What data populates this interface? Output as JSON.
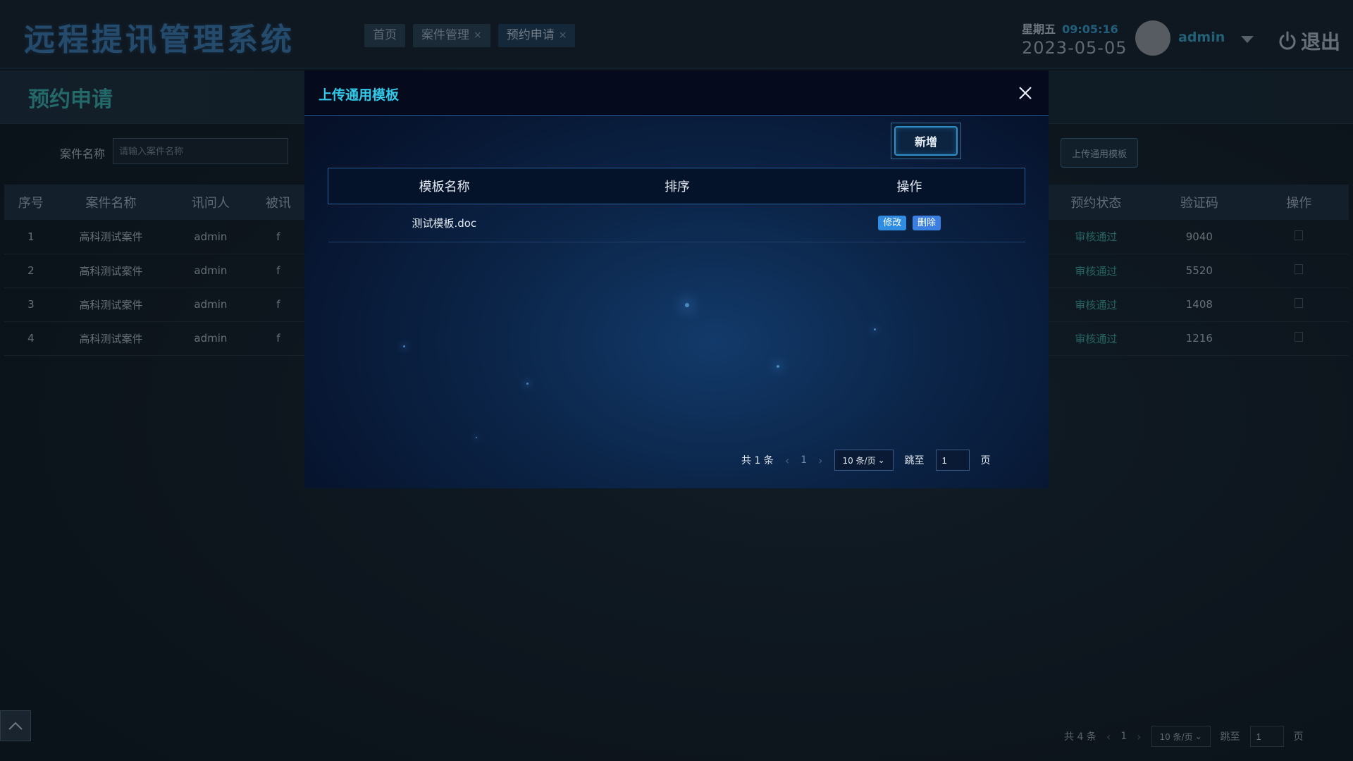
{
  "header": {
    "app_title": "远程提讯管理系统",
    "tabs": [
      {
        "label": "首页",
        "closable": false
      },
      {
        "label": "案件管理",
        "closable": true
      },
      {
        "label": "预约申请",
        "closable": true
      }
    ],
    "tab_close_glyph": "×",
    "weekday": "星期五",
    "time": "09:05:16",
    "date": "2023-05-05",
    "username": "admin",
    "logout_label": "退出"
  },
  "page": {
    "title": "预约申请",
    "filter": {
      "label": "案件名称",
      "placeholder": "请输入案件名称"
    },
    "upload_button": "上传通用模板",
    "table": {
      "headers": [
        "序号",
        "案件名称",
        "讯问人",
        "被讯",
        "预约状态",
        "验证码",
        "操作"
      ],
      "rows": [
        {
          "index": "1",
          "case": "高科测试案件",
          "interrogator": "admin",
          "partial": "f",
          "status": "审核通过",
          "code": "9040"
        },
        {
          "index": "2",
          "case": "高科测试案件",
          "interrogator": "admin",
          "partial": "f",
          "status": "审核通过",
          "code": "5520"
        },
        {
          "index": "3",
          "case": "高科测试案件",
          "interrogator": "admin",
          "partial": "f",
          "status": "审核通过",
          "code": "1408"
        },
        {
          "index": "4",
          "case": "高科测试案件",
          "interrogator": "admin",
          "partial": "f",
          "status": "审核通过",
          "code": "1216"
        }
      ]
    },
    "pagination": {
      "total": "共 4 条",
      "page": "1",
      "page_size": "10 条/页",
      "jump_label": "跳至",
      "jump_value": "1",
      "page_suffix": "页"
    }
  },
  "modal": {
    "title": "上传通用模板",
    "add_button": "新增",
    "table": {
      "headers": [
        "模板名称",
        "排序",
        "操作"
      ],
      "rows": [
        {
          "name": "测试模板.doc",
          "order": "",
          "edit_label": "修改",
          "delete_label": "删除"
        }
      ]
    },
    "pagination": {
      "total": "共 1 条",
      "page": "1",
      "page_size": "10 条/页",
      "jump_label": "跳至",
      "jump_value": "1",
      "page_suffix": "页"
    }
  },
  "icons": {
    "close": "close-icon",
    "power": "power-icon",
    "caret": "chevron-down-icon",
    "scroll_top": "chevron-up-icon",
    "row_action": "document-icon"
  },
  "colors": {
    "accent_teal": "#3fb7b2",
    "accent_blue": "#33c8e8",
    "status_pass": "#3fb0a8",
    "button_blue": "#2f8ce0"
  }
}
